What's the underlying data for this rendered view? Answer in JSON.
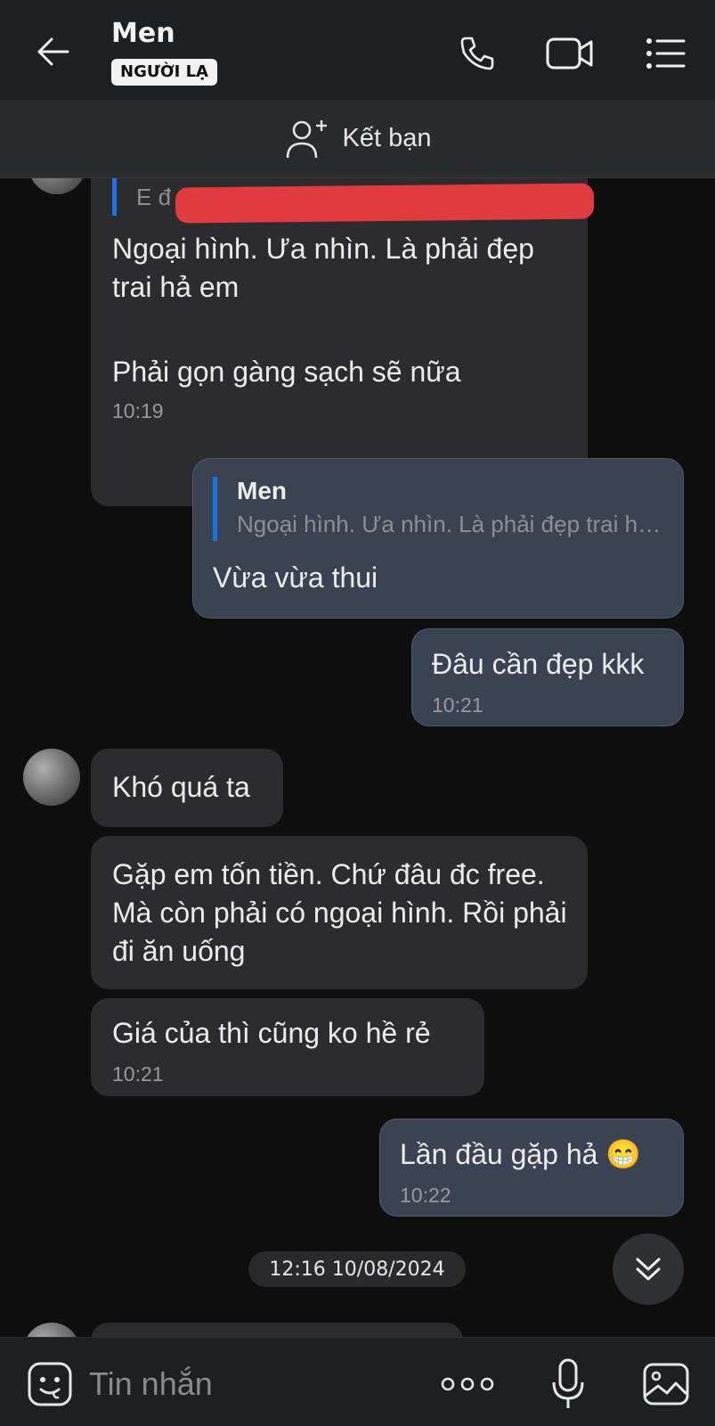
{
  "header": {
    "title": "Men",
    "badge": "NGƯỜI LẠ"
  },
  "friend_bar": {
    "label": "Kết bạn"
  },
  "messages": {
    "m1_reply_preview": "E đ",
    "m1_text": "Ngoại hình. Ưa nhìn. Là phải đẹp trai hả em",
    "m2_text": "Phải gọn gàng sạch sẽ nữa",
    "m2_time": "10:19",
    "m3_quote_name": "Men",
    "m3_quote_text": "Ngoại hình. Ưa nhìn. Là phải đẹp trai hả em",
    "m3_text": "Vừa vừa thui",
    "m4_text": "Đâu cần đẹp kkk",
    "m4_time": "10:21",
    "m5_text": "Khó quá ta",
    "m6_text": "Gặp em tốn tiền. Chứ đâu đc free. Mà còn phải có ngoại hình. Rồi phải đi ăn uống",
    "m7_text": "Giá của thì cũng ko hề rẻ",
    "m7_time": "10:21",
    "m8_text": "Lần đầu gặp hả 😁",
    "m8_time": "10:22"
  },
  "date_separator": "12:16 10/08/2024",
  "input": {
    "placeholder": "Tin nhắn"
  },
  "colors": {
    "background": "#0f0f10",
    "incoming_bubble": "#2c2c2e",
    "outgoing_bubble": "#3b4352",
    "quote_accent": "#1a73e8",
    "redaction": "#e13b3f"
  },
  "icons": [
    "back-arrow-icon",
    "phone-icon",
    "video-camera-icon",
    "menu-list-icon",
    "add-friend-icon",
    "chevron-double-down-icon",
    "emoji-icon",
    "more-dots-icon",
    "microphone-icon",
    "image-icon"
  ]
}
